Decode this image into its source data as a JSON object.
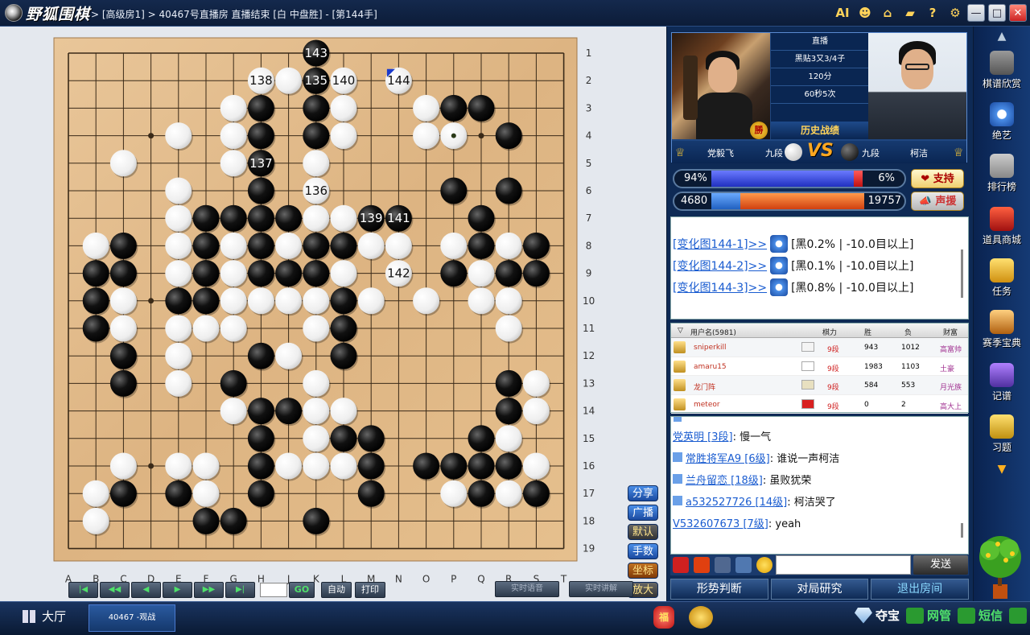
{
  "app": {
    "title": "野狐围棋",
    "breadcrumb": "> [高级房1] > 40467号直播房 直播结束 [白 中盘胜] - [第144手]"
  },
  "titlebar": {
    "icons": [
      "ai-icon",
      "user-icon",
      "home-icon",
      "shirt-icon",
      "help-icon",
      "gear-icon"
    ],
    "ai_label": "AI",
    "help_label": "?"
  },
  "board": {
    "size": 19,
    "columns": [
      "A",
      "B",
      "C",
      "D",
      "E",
      "F",
      "G",
      "H",
      "J",
      "K",
      "L",
      "M",
      "N",
      "O",
      "P",
      "Q",
      "R",
      "S",
      "T"
    ],
    "row_labels": [
      "1",
      "2",
      "3",
      "4",
      "5",
      "6",
      "7",
      "8",
      "9",
      "10",
      "11",
      "12",
      "13",
      "14",
      "15",
      "16",
      "17",
      "18",
      "19"
    ],
    "stones": [
      [
        "b",
        "K",
        1
      ],
      [
        "w",
        "H",
        2
      ],
      [
        "w",
        "J",
        2
      ],
      [
        "b",
        "K",
        2
      ],
      [
        "w",
        "L",
        2
      ],
      [
        "w",
        "N",
        2
      ],
      [
        "w",
        "G",
        3
      ],
      [
        "b",
        "H",
        3
      ],
      [
        "b",
        "K",
        3
      ],
      [
        "w",
        "L",
        3
      ],
      [
        "w",
        "O",
        3
      ],
      [
        "b",
        "P",
        3
      ],
      [
        "b",
        "Q",
        3
      ],
      [
        "w",
        "E",
        4
      ],
      [
        "w",
        "G",
        4
      ],
      [
        "b",
        "H",
        4
      ],
      [
        "b",
        "K",
        4
      ],
      [
        "w",
        "L",
        4
      ],
      [
        "w",
        "O",
        4
      ],
      [
        "w",
        "P",
        4
      ],
      [
        "b",
        "R",
        4
      ],
      [
        "w",
        "C",
        5
      ],
      [
        "w",
        "G",
        5
      ],
      [
        "b",
        "H",
        5
      ],
      [
        "w",
        "K",
        5
      ],
      [
        "w",
        "E",
        6
      ],
      [
        "b",
        "H",
        6
      ],
      [
        "w",
        "K",
        6
      ],
      [
        "b",
        "P",
        6
      ],
      [
        "b",
        "R",
        6
      ],
      [
        "w",
        "E",
        7
      ],
      [
        "b",
        "F",
        7
      ],
      [
        "b",
        "G",
        7
      ],
      [
        "b",
        "H",
        7
      ],
      [
        "b",
        "J",
        7
      ],
      [
        "w",
        "K",
        7
      ],
      [
        "w",
        "L",
        7
      ],
      [
        "b",
        "M",
        7
      ],
      [
        "b",
        "N",
        7
      ],
      [
        "b",
        "Q",
        7
      ],
      [
        "w",
        "B",
        8
      ],
      [
        "b",
        "C",
        8
      ],
      [
        "w",
        "E",
        8
      ],
      [
        "b",
        "F",
        8
      ],
      [
        "w",
        "G",
        8
      ],
      [
        "b",
        "H",
        8
      ],
      [
        "w",
        "J",
        8
      ],
      [
        "b",
        "K",
        8
      ],
      [
        "b",
        "L",
        8
      ],
      [
        "w",
        "M",
        8
      ],
      [
        "w",
        "N",
        8
      ],
      [
        "w",
        "P",
        8
      ],
      [
        "b",
        "Q",
        8
      ],
      [
        "w",
        "R",
        8
      ],
      [
        "b",
        "S",
        8
      ],
      [
        "b",
        "B",
        9
      ],
      [
        "b",
        "C",
        9
      ],
      [
        "w",
        "E",
        9
      ],
      [
        "b",
        "F",
        9
      ],
      [
        "w",
        "G",
        9
      ],
      [
        "b",
        "H",
        9
      ],
      [
        "b",
        "J",
        9
      ],
      [
        "b",
        "K",
        9
      ],
      [
        "w",
        "L",
        9
      ],
      [
        "w",
        "N",
        9
      ],
      [
        "b",
        "P",
        9
      ],
      [
        "w",
        "Q",
        9
      ],
      [
        "b",
        "R",
        9
      ],
      [
        "b",
        "S",
        9
      ],
      [
        "b",
        "B",
        10
      ],
      [
        "w",
        "C",
        10
      ],
      [
        "b",
        "E",
        10
      ],
      [
        "b",
        "F",
        10
      ],
      [
        "w",
        "G",
        10
      ],
      [
        "w",
        "H",
        10
      ],
      [
        "w",
        "J",
        10
      ],
      [
        "w",
        "K",
        10
      ],
      [
        "b",
        "L",
        10
      ],
      [
        "w",
        "M",
        10
      ],
      [
        "w",
        "O",
        10
      ],
      [
        "w",
        "Q",
        10
      ],
      [
        "w",
        "R",
        10
      ],
      [
        "b",
        "B",
        11
      ],
      [
        "w",
        "C",
        11
      ],
      [
        "w",
        "E",
        11
      ],
      [
        "w",
        "F",
        11
      ],
      [
        "w",
        "G",
        11
      ],
      [
        "w",
        "K",
        11
      ],
      [
        "b",
        "L",
        11
      ],
      [
        "w",
        "R",
        11
      ],
      [
        "b",
        "C",
        12
      ],
      [
        "w",
        "E",
        12
      ],
      [
        "b",
        "H",
        12
      ],
      [
        "w",
        "J",
        12
      ],
      [
        "b",
        "L",
        12
      ],
      [
        "b",
        "C",
        13
      ],
      [
        "w",
        "E",
        13
      ],
      [
        "b",
        "G",
        13
      ],
      [
        "w",
        "K",
        13
      ],
      [
        "b",
        "R",
        13
      ],
      [
        "w",
        "S",
        13
      ],
      [
        "w",
        "G",
        14
      ],
      [
        "b",
        "H",
        14
      ],
      [
        "b",
        "J",
        14
      ],
      [
        "w",
        "K",
        14
      ],
      [
        "w",
        "L",
        14
      ],
      [
        "b",
        "R",
        14
      ],
      [
        "w",
        "S",
        14
      ],
      [
        "b",
        "H",
        15
      ],
      [
        "w",
        "K",
        15
      ],
      [
        "b",
        "L",
        15
      ],
      [
        "b",
        "M",
        15
      ],
      [
        "b",
        "Q",
        15
      ],
      [
        "w",
        "R",
        15
      ],
      [
        "w",
        "C",
        16
      ],
      [
        "w",
        "E",
        16
      ],
      [
        "w",
        "F",
        16
      ],
      [
        "b",
        "H",
        16
      ],
      [
        "w",
        "J",
        16
      ],
      [
        "w",
        "K",
        16
      ],
      [
        "w",
        "L",
        16
      ],
      [
        "b",
        "M",
        16
      ],
      [
        "b",
        "O",
        16
      ],
      [
        "b",
        "P",
        16
      ],
      [
        "b",
        "Q",
        16
      ],
      [
        "b",
        "R",
        16
      ],
      [
        "w",
        "S",
        16
      ],
      [
        "w",
        "B",
        17
      ],
      [
        "b",
        "C",
        17
      ],
      [
        "b",
        "E",
        17
      ],
      [
        "w",
        "F",
        17
      ],
      [
        "b",
        "H",
        17
      ],
      [
        "b",
        "M",
        17
      ],
      [
        "w",
        "P",
        17
      ],
      [
        "b",
        "Q",
        17
      ],
      [
        "w",
        "R",
        17
      ],
      [
        "b",
        "S",
        17
      ],
      [
        "w",
        "B",
        18
      ],
      [
        "b",
        "F",
        18
      ],
      [
        "b",
        "G",
        18
      ],
      [
        "b",
        "K",
        18
      ]
    ],
    "numbered": [
      {
        "color": "b",
        "col": "K",
        "row": 1,
        "num": "143"
      },
      {
        "color": "w",
        "col": "H",
        "row": 2,
        "num": "138"
      },
      {
        "color": "b",
        "col": "K",
        "row": 2,
        "num": "135"
      },
      {
        "color": "w",
        "col": "L",
        "row": 2,
        "num": "140"
      },
      {
        "color": "w",
        "col": "N",
        "row": 2,
        "num": "144"
      },
      {
        "color": "b",
        "col": "H",
        "row": 5,
        "num": "137"
      },
      {
        "color": "w",
        "col": "K",
        "row": 6,
        "num": "136"
      },
      {
        "color": "b",
        "col": "M",
        "row": 7,
        "num": "139"
      },
      {
        "color": "b",
        "col": "N",
        "row": 7,
        "num": "141"
      },
      {
        "color": "w",
        "col": "N",
        "row": 9,
        "num": "142"
      }
    ],
    "last_move": {
      "col": "N",
      "row": 2
    }
  },
  "controls": {
    "go_label": "GO",
    "auto_label": "自动",
    "print_label": "打印",
    "voice_label": "实时语音",
    "explain_label": "实时讲解"
  },
  "side_tools": [
    "分享",
    "广播",
    "默认",
    "手数",
    "坐标",
    "放大"
  ],
  "match": {
    "mode": "直播",
    "komi": "黑贴3又3/4子",
    "time": "120分",
    "byoyomi": "60秒5次",
    "history": "历史战绩",
    "win_badge": "勝",
    "lose_badge": "負",
    "white_name": "党毅飞",
    "white_rank": "九段",
    "black_rank": "九段",
    "black_name": "柯洁",
    "vs": "VS",
    "win_rate": {
      "left": "94%",
      "right": "6%",
      "left_value": 0.94
    },
    "support": {
      "left": "4680",
      "right": "19757",
      "left_value": 0.19
    },
    "support_btn": "支持",
    "cheer_btn": "声援"
  },
  "variations": [
    {
      "link": "[变化图144-1]>>",
      "text": "[黑0.2% | -10.0目以上]"
    },
    {
      "link": "[变化图144-2]>>",
      "text": "[黑0.1% | -10.0目以上]"
    },
    {
      "link": "[变化图144-3]>>",
      "text": "[黑0.8% | -10.0目以上]"
    }
  ],
  "users": {
    "headers": {
      "name": "用户名(5981)",
      "rank": "棋力",
      "win": "胜",
      "lose": "负",
      "wealth": "财富"
    },
    "rows": [
      {
        "name": "sniperkill",
        "rank": "9段",
        "win": "943",
        "lose": "1012",
        "wealth": "高富帅",
        "flag": "#f4f4f4"
      },
      {
        "name": "amaru15",
        "rank": "9段",
        "win": "1983",
        "lose": "1103",
        "wealth": "土豪",
        "flag": "#ffffff"
      },
      {
        "name": "龙门阵",
        "rank": "9段",
        "win": "584",
        "lose": "553",
        "wealth": "月光族",
        "flag": "#e8e0c0"
      },
      {
        "name": "meteor",
        "rank": "9段",
        "win": "0",
        "lose": "2",
        "wealth": "高大上",
        "flag": "#d82020"
      }
    ]
  },
  "chat": [
    {
      "name": "党英明 [3段]",
      "msg": ": 慢一气"
    },
    {
      "name": "常胜将军A9 [6级]",
      "msg": ": 谁说一声柯洁"
    },
    {
      "name": "兰舟留恋 [18级]",
      "msg": ": 虽败犹荣"
    },
    {
      "name": "a532527726 [14级]",
      "msg": ": 柯洁哭了"
    },
    {
      "name": "V532607673 [7级]",
      "msg": ": yeah"
    }
  ],
  "chat_send": "发送",
  "actions": [
    "形势判断",
    "对局研究",
    "退出房间"
  ],
  "far_right": [
    "棋谱欣赏",
    "绝艺",
    "排行榜",
    "道具商城",
    "任务",
    "赛季宝典",
    "记谱",
    "习题"
  ],
  "taskbar": {
    "lobby": "大厅",
    "tab": "40467 -观战",
    "fu": "福",
    "treasure": "夺宝",
    "net": "网管",
    "sms": "短信"
  }
}
